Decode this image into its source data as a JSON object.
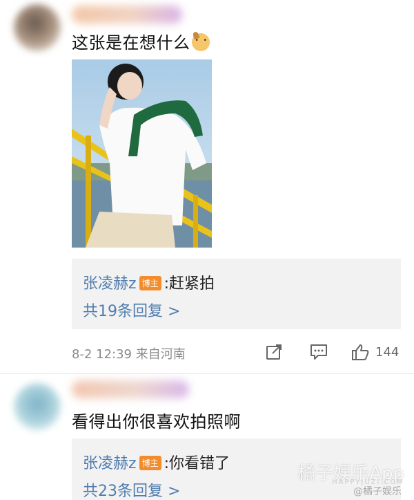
{
  "comments": [
    {
      "text": "这张是在想什么",
      "emoji_icon": "shiba-dog-emoji",
      "has_photo": true,
      "reply": {
        "author": "张凌赫z",
        "badge": "博主",
        "content": ":赶紧拍",
        "count_label": "共19条回复 >"
      },
      "timestamp": "8-2 12:39 来自河南",
      "likes": "144"
    },
    {
      "text": "看得出你很喜欢拍照啊",
      "reply": {
        "author": "张凌赫z",
        "badge": "博主",
        "content": ":你看错了",
        "count_label": "共23条回复 >"
      }
    }
  ],
  "watermark": {
    "brand": "橘子娱乐App",
    "sub": "HAPPYJUZI.COM",
    "credit": "@橘子娱乐"
  },
  "colors": {
    "link_blue": "#507daf",
    "badge_orange": "#f28d2e",
    "reply_bg": "#f2f2f2",
    "meta_gray": "#8a8a8a"
  }
}
